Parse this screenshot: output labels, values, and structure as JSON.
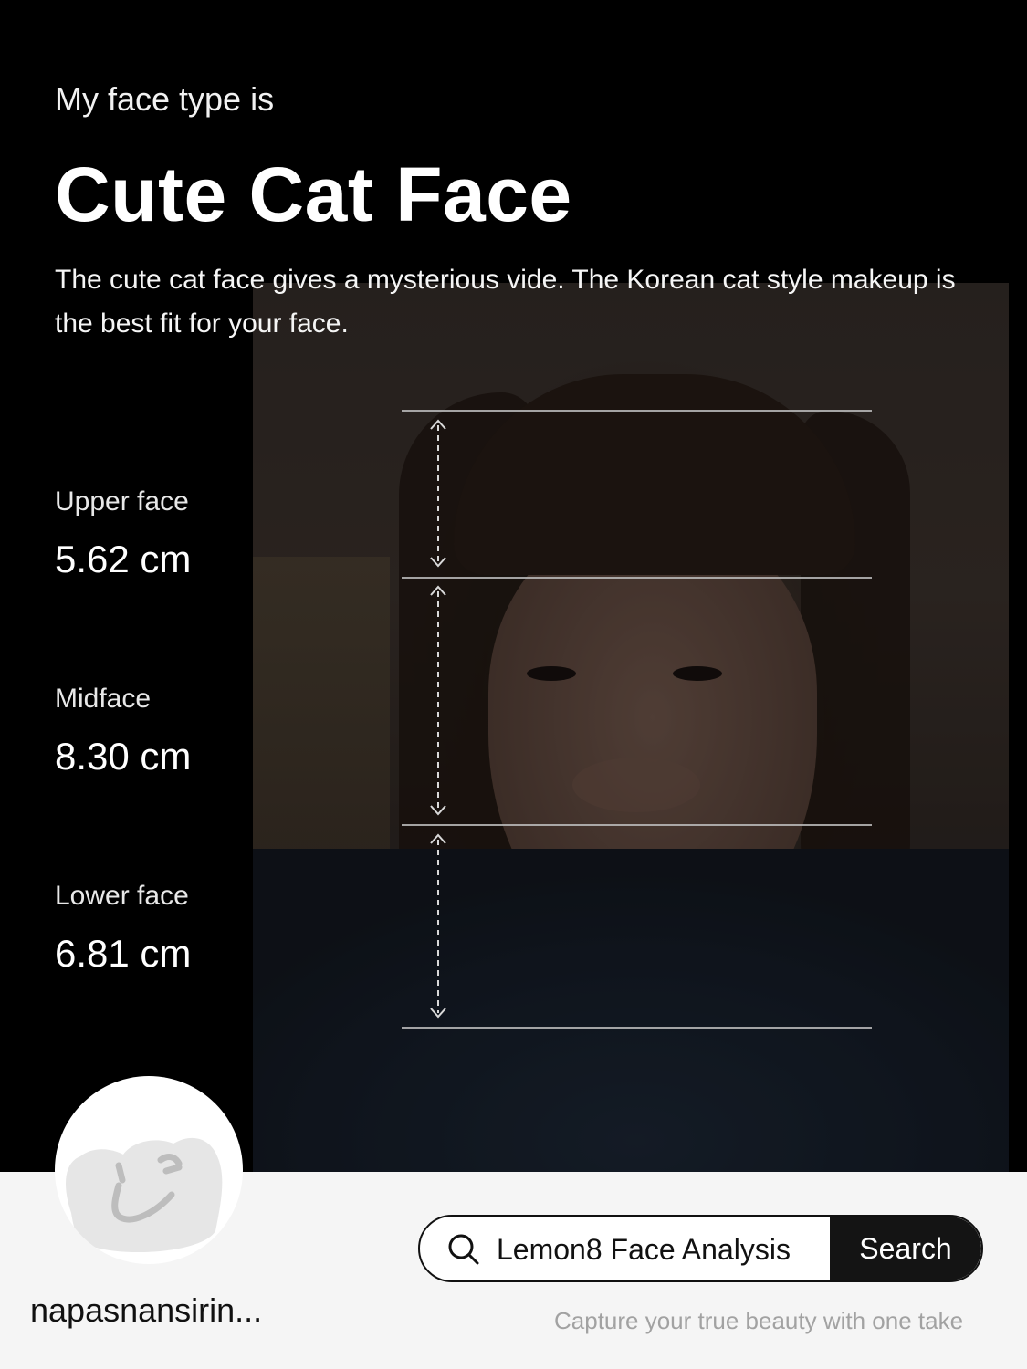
{
  "header": {
    "intro": "My face type is",
    "face_type": "Cute Cat Face",
    "description": "The cute cat face gives a mysterious vide. The Korean cat style makeup is the best fit for your face."
  },
  "measurements": [
    {
      "label": "Upper face",
      "value": "5.62 cm"
    },
    {
      "label": "Midface",
      "value": "8.30 cm"
    },
    {
      "label": "Lower face",
      "value": "6.81 cm"
    }
  ],
  "footer": {
    "username": "napasnansirin...",
    "search_query": "Lemon8 Face Analysis",
    "search_button": "Search",
    "tagline": "Capture your true beauty with one take"
  },
  "icons": {
    "search": "search-icon",
    "avatar": "winking-cat-avatar-icon"
  },
  "colors": {
    "background": "#000000",
    "footer_background": "#f5f5f5",
    "search_button": "#141414",
    "tagline": "#a2a2a2"
  }
}
